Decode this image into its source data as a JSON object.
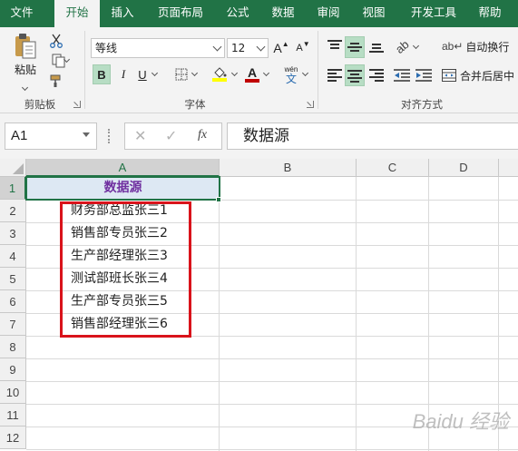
{
  "tabs": [
    "文件",
    "开始",
    "插入",
    "页面布局",
    "公式",
    "数据",
    "审阅",
    "视图",
    "开发工具",
    "帮助"
  ],
  "clipboard": {
    "paste_label": "粘贴",
    "group_label": "剪贴板"
  },
  "font": {
    "name": "等线",
    "size": "12",
    "bold": "B",
    "italic": "I",
    "underline": "U",
    "phonetic": "wén",
    "phonetic_char": "文",
    "group_label": "字体",
    "grow": "A",
    "shrink": "A"
  },
  "alignment": {
    "wrap_text": "自动换行",
    "merge_center": "合并后居中",
    "group_label": "对齐方式"
  },
  "formula_bar": {
    "name_box": "A1",
    "fx": "fx",
    "content": "数据源"
  },
  "columns": [
    "A",
    "B",
    "C",
    "D"
  ],
  "rows": [
    "1",
    "2",
    "3",
    "4",
    "5",
    "6",
    "7",
    "8",
    "9",
    "10",
    "11",
    "12"
  ],
  "cells": {
    "A1": "数据源",
    "A2": "财务部总监张三1",
    "A3": "销售部专员张三2",
    "A4": "生产部经理张三3",
    "A5": "测试部班长张三4",
    "A6": "生产部专员张三5",
    "A7": "销售部经理张三6"
  },
  "colors": {
    "excel_green": "#217346",
    "header_fill": "#dde8f3",
    "header_text": "#7030a0",
    "highlight_box": "#d9131b",
    "font_color_bar": "#c00000",
    "fill_color_bar": "#ffff00"
  },
  "watermark": "Baidu 经验"
}
